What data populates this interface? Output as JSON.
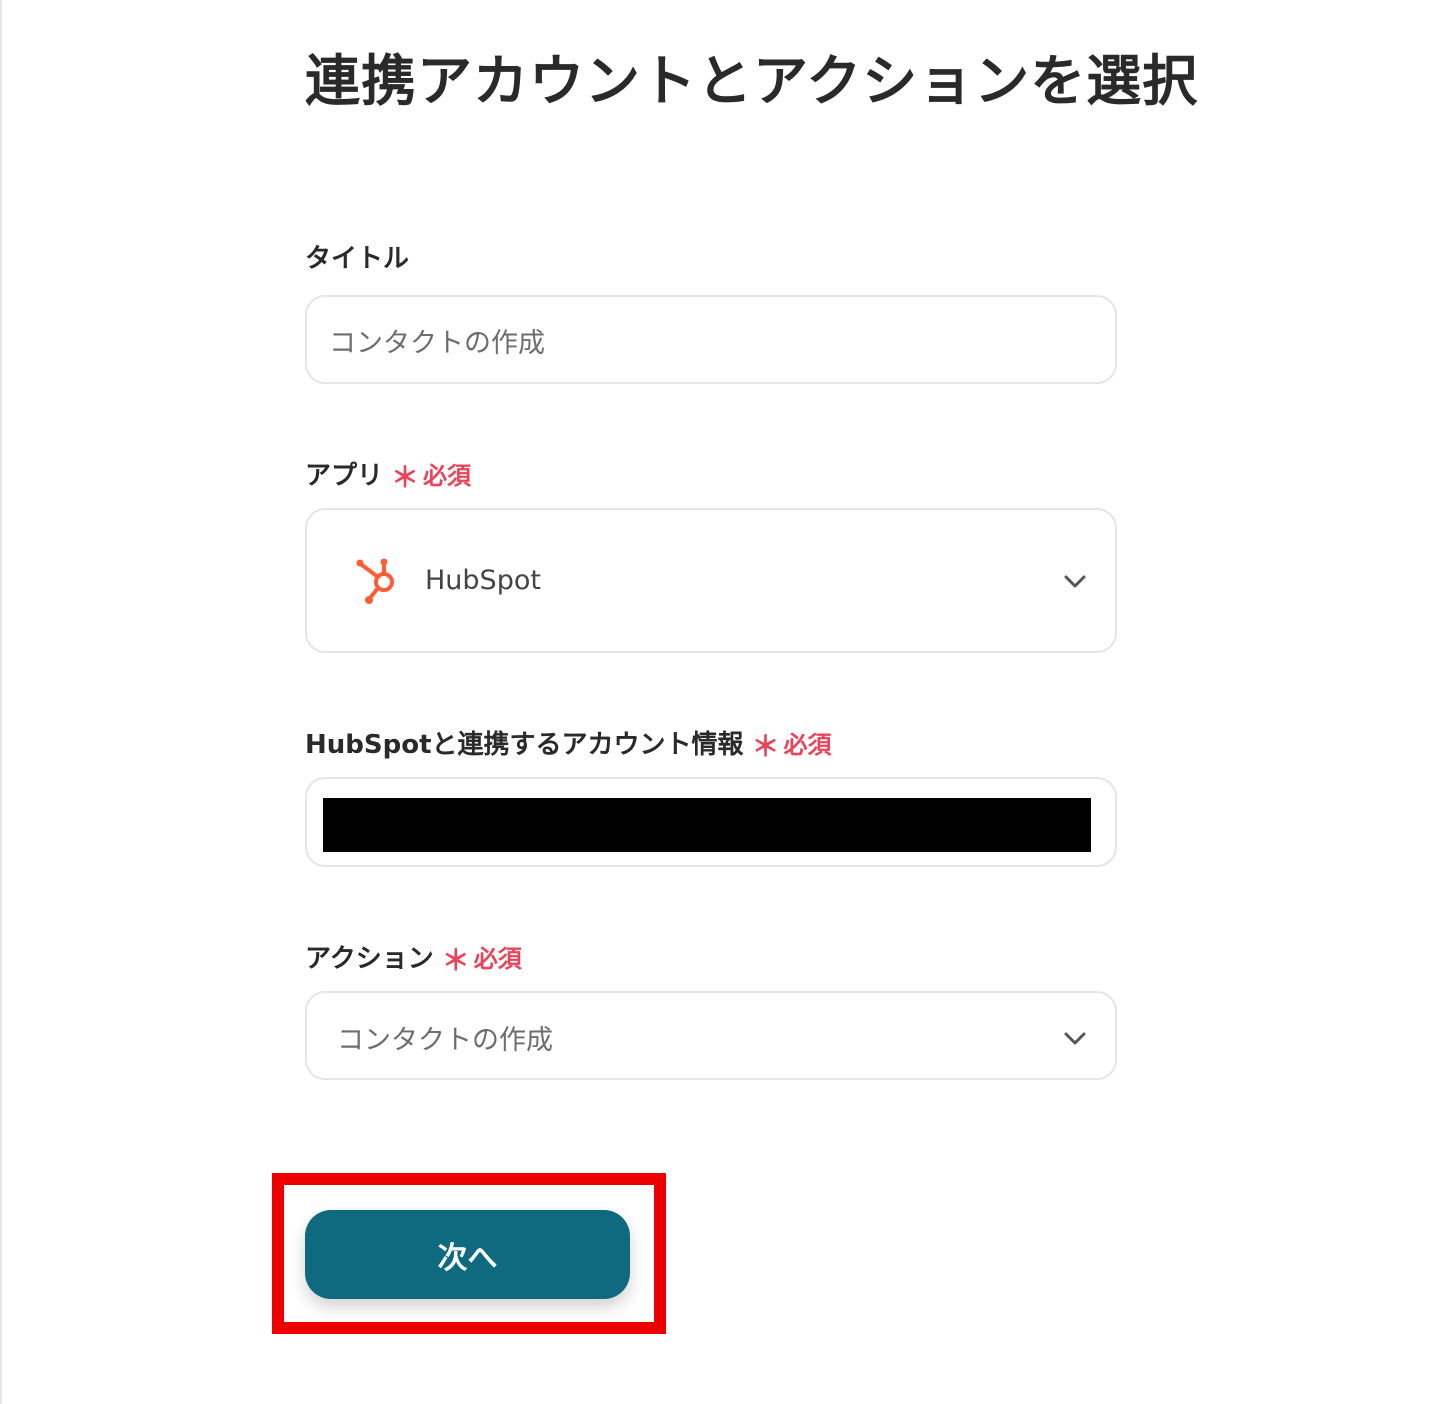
{
  "page": {
    "title": "連携アカウントとアクションを選択"
  },
  "form": {
    "title_field": {
      "label": "タイトル",
      "value": "コンタクトの作成"
    },
    "app_field": {
      "label": "アプリ",
      "required_star": "＊",
      "required_text": "必須",
      "selected": "HubSpot",
      "icon": "hubspot-logo"
    },
    "account_field": {
      "label": "HubSpotと連携するアカウント情報",
      "required_star": "＊",
      "required_text": "必須",
      "value_redacted": true
    },
    "action_field": {
      "label": "アクション",
      "required_star": "＊",
      "required_text": "必須",
      "selected": "コンタクトの作成"
    },
    "next_button": {
      "label": "次へ"
    }
  },
  "colors": {
    "accent_button": "#0f6a80",
    "required": "#e8455a",
    "hubspot_orange": "#ff5c35",
    "highlight": "#ee0000"
  }
}
